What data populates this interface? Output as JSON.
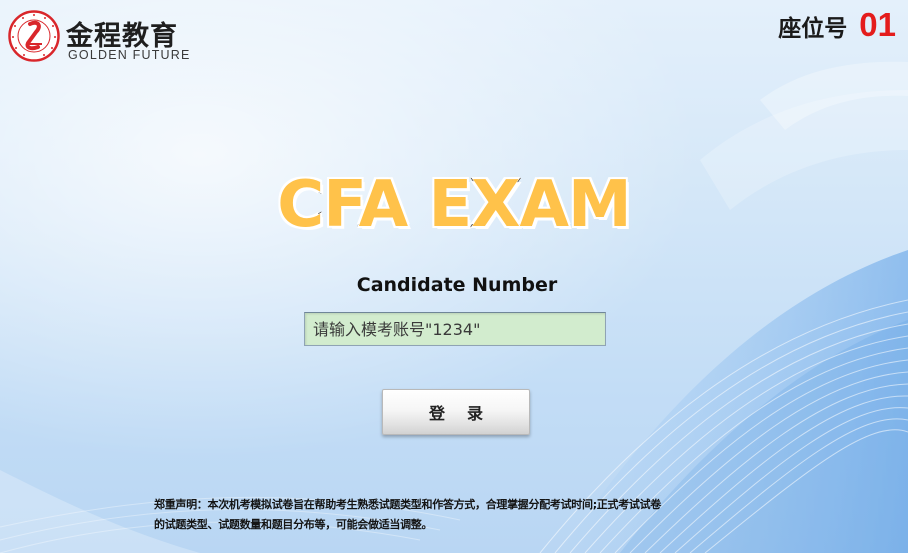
{
  "logo": {
    "name_cn": "金程教育",
    "name_en": "GOLDEN FUTURE",
    "icon": "golden-future-seal-icon",
    "brand_color": "#d9262b"
  },
  "seat": {
    "label": "座位号",
    "number": "01",
    "number_color": "#e41c1c"
  },
  "title": "CFA EXAM",
  "form": {
    "candidate_label": "Candidate Number",
    "account_input": {
      "value": "",
      "placeholder": "请输入模考账号\"1234\""
    },
    "login_label": "登录"
  },
  "disclaimer": {
    "lines": [
      "郑重声明：本次机考模拟试卷旨在帮助考生熟悉试题类型和作答方式，合理掌握分配考试时间;正式考试试卷",
      "的试题类型、试题数量和题目分布等，可能会做适当调整。"
    ]
  }
}
